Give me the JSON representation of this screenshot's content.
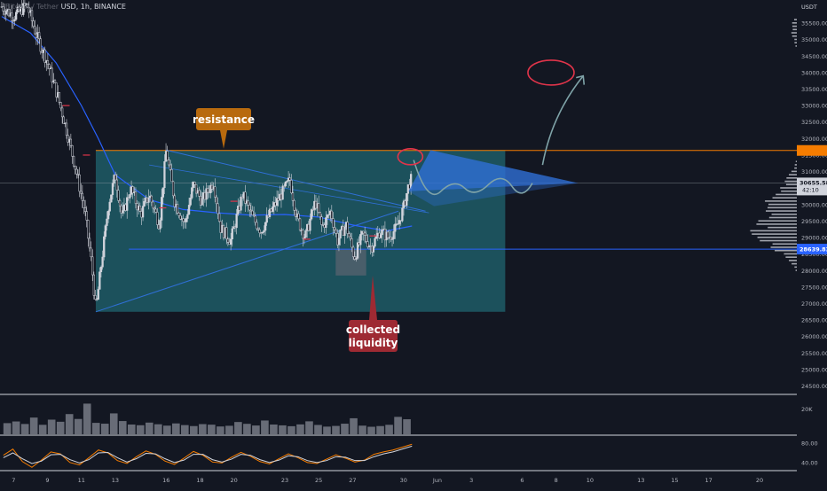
{
  "header": {
    "symbol_suffix": "USD, 1h, BINANCE"
  },
  "currency_label": "USDT",
  "colors": {
    "background": "#131722",
    "zone": "#1e5c66",
    "candle_up": "#d1d4dc",
    "candle_down": "#d1d4dc",
    "ma_line": "#2962ff",
    "triangle": "#2f6fd6",
    "resistance_line": "#f57c00",
    "support_line": "#2962ff",
    "resistance_label_bg": "#b86a0e",
    "liquidity_label_bg": "#9e2a33",
    "current_price_bg": "#d1d4dc",
    "support_price_bg": "#2962ff",
    "circle": "#e0344a",
    "projection": "#7fa3a8"
  },
  "annotations": {
    "resistance_label": "resistance",
    "liquidity_label_line1": "collected",
    "liquidity_label_line2": "liquidity"
  },
  "chart_data": [
    {
      "type": "candlestick",
      "title": "",
      "exchange": "BINANCE",
      "timeframe": "1h",
      "y_ticks": [
        35500,
        35000,
        34500,
        34000,
        33500,
        33000,
        32500,
        32000,
        31500,
        31000,
        30500,
        30000,
        29500,
        29000,
        28500,
        28000,
        27500,
        27000,
        26500,
        26000,
        25500,
        25000,
        24500
      ],
      "ylim": [
        24300,
        36200
      ],
      "x_tick_labels": [
        "7",
        "9",
        "11",
        "13",
        "16",
        "18",
        "20",
        "23",
        "25",
        "27",
        "30",
        "Jun",
        "3",
        "6",
        "8",
        "10",
        "13",
        "15",
        "17",
        "20"
      ],
      "x_tick_days": [
        7,
        9,
        11,
        13,
        16,
        18,
        20,
        23,
        25,
        27,
        30,
        32,
        34,
        37,
        39,
        41,
        44,
        46,
        48,
        51
      ],
      "xlim": [
        6.2,
        53.2
      ],
      "current_price": "30655.58",
      "countdown": "42:10",
      "support_price": "28639.83",
      "resistance_level": 31640,
      "support_level": 28650,
      "price_path": [
        [
          6.3,
          36000
        ],
        [
          7.0,
          35700
        ],
        [
          7.8,
          36050
        ],
        [
          8.3,
          35200
        ],
        [
          9.0,
          34300
        ],
        [
          9.6,
          33300
        ],
        [
          10.2,
          32100
        ],
        [
          10.7,
          31000
        ],
        [
          11.2,
          29800
        ],
        [
          11.6,
          28200
        ],
        [
          11.85,
          26800
        ],
        [
          12.2,
          28300
        ],
        [
          12.6,
          30000
        ],
        [
          13.0,
          30900
        ],
        [
          13.4,
          29600
        ],
        [
          13.9,
          30500
        ],
        [
          14.5,
          29700
        ],
        [
          15.0,
          30300
        ],
        [
          15.6,
          29400
        ],
        [
          16.0,
          31650
        ],
        [
          16.5,
          30100
        ],
        [
          17.1,
          29400
        ],
        [
          17.6,
          30600
        ],
        [
          18.1,
          30100
        ],
        [
          18.8,
          30700
        ],
        [
          19.2,
          29300
        ],
        [
          19.8,
          28900
        ],
        [
          20.5,
          30300
        ],
        [
          21.1,
          29600
        ],
        [
          21.6,
          29200
        ],
        [
          22.3,
          29900
        ],
        [
          22.9,
          30400
        ],
        [
          23.3,
          30750
        ],
        [
          23.7,
          29600
        ],
        [
          24.2,
          29000
        ],
        [
          24.8,
          30100
        ],
        [
          25.2,
          29300
        ],
        [
          25.7,
          29800
        ],
        [
          26.1,
          28900
        ],
        [
          26.6,
          29400
        ],
        [
          27.1,
          28400
        ],
        [
          27.6,
          29100
        ],
        [
          28.1,
          28700
        ],
        [
          28.6,
          29200
        ],
        [
          29.1,
          29000
        ],
        [
          29.6,
          29300
        ],
        [
          30.0,
          29900
        ],
        [
          30.3,
          30600
        ],
        [
          30.5,
          30800
        ]
      ],
      "ma_path": [
        [
          6.3,
          35700
        ],
        [
          8.0,
          35200
        ],
        [
          9.5,
          34300
        ],
        [
          11.0,
          33000
        ],
        [
          12.0,
          32000
        ],
        [
          13.0,
          30900
        ],
        [
          15.0,
          30150
        ],
        [
          17.0,
          29850
        ],
        [
          19.0,
          29750
        ],
        [
          21.0,
          29680
        ],
        [
          23.0,
          29700
        ],
        [
          25.0,
          29620
        ],
        [
          27.0,
          29380
        ],
        [
          29.0,
          29200
        ],
        [
          30.5,
          29350
        ]
      ],
      "zone": {
        "x0": 11.85,
        "x1": 36.0,
        "y0": 26750,
        "y1": 31650
      },
      "lower_trendline": {
        "x0": 11.85,
        "y0": 26750,
        "x1": 29.7,
        "y1": 29800
      },
      "upper_trendline": {
        "x0": 16.0,
        "y0": 31650,
        "x1": 31.3,
        "y1": 29800
      },
      "triangle_projection": {
        "apex_x": 30.3,
        "apex_y": 30400,
        "top_x": 31.6,
        "top_y": 31650,
        "tip_x": 40.3,
        "tip_y": 30650
      }
    },
    {
      "type": "bar",
      "title": "",
      "axis_label": "20K",
      "ylim": [
        0,
        28000
      ],
      "values": [
        8000,
        9200,
        7400,
        12000,
        6800,
        10500,
        9000,
        14500,
        11000,
        22000,
        8200,
        7600,
        15000,
        9500,
        7000,
        6500,
        8400,
        7200,
        6200,
        7800,
        6600,
        5900,
        7300,
        6900,
        5600,
        6100,
        8800,
        7500,
        6300,
        9900,
        7000,
        6400,
        5800,
        7100,
        9300,
        6700,
        5500,
        6000,
        7600,
        11500,
        6200,
        5400,
        5900,
        6800,
        12500,
        10800
      ]
    },
    {
      "type": "line",
      "title": "",
      "axis_ticks": [
        80,
        40
      ],
      "ylim": [
        25,
        95
      ],
      "series": [
        {
          "values": [
            55,
            68,
            42,
            30,
            45,
            62,
            58,
            40,
            35,
            50,
            66,
            60,
            44,
            38,
            52,
            64,
            57,
            43,
            36,
            49,
            63,
            55,
            41,
            39,
            51,
            61,
            53,
            42,
            37,
            48,
            58,
            50,
            40,
            38,
            47,
            56,
            49,
            41,
            45,
            57,
            62,
            66,
            72,
            78
          ]
        },
        {
          "values": [
            50,
            60,
            48,
            38,
            43,
            56,
            57,
            46,
            39,
            46,
            60,
            61,
            50,
            41,
            48,
            59,
            58,
            48,
            40,
            45,
            57,
            57,
            46,
            41,
            47,
            57,
            55,
            46,
            40,
            45,
            54,
            52,
            44,
            40,
            44,
            52,
            51,
            44,
            44,
            52,
            58,
            62,
            68,
            74
          ]
        }
      ]
    }
  ]
}
